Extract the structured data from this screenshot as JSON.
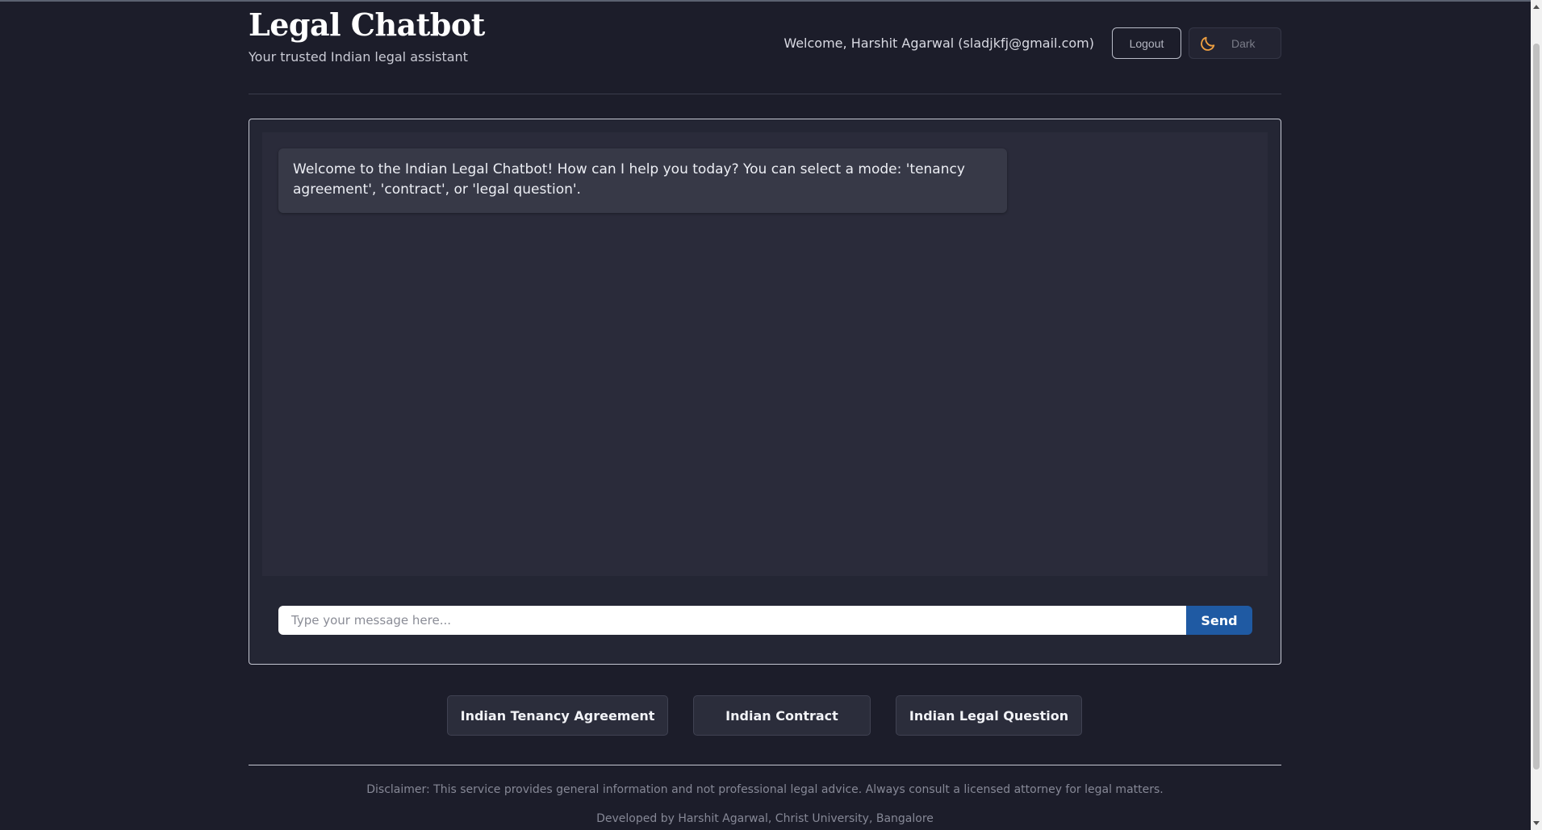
{
  "header": {
    "title": "Legal Chatbot",
    "subtitle": "Your trusted Indian legal assistant",
    "welcome": "Welcome, Harshit Agarwal (sladjkfj@gmail.com)",
    "logout_label": "Logout",
    "theme_label": "Dark",
    "theme_icon": "moon-icon"
  },
  "chat": {
    "messages": [
      {
        "role": "bot",
        "text": "Welcome to the Indian Legal Chatbot! How can I help you today? You can select a mode: 'tenancy agreement', 'contract', or 'legal question'."
      }
    ],
    "input_placeholder": "Type your message here...",
    "input_value": "",
    "send_label": "Send"
  },
  "modes": [
    {
      "label": "Indian Tenancy Agreement"
    },
    {
      "label": "Indian Contract"
    },
    {
      "label": "Indian Legal Question"
    }
  ],
  "footer": {
    "disclaimer": "Disclaimer: This service provides general information and not professional legal advice. Always consult a licensed attorney for legal matters.",
    "credit": "Developed by Harshit Agarwal, Christ University, Bangalore"
  },
  "colors": {
    "background": "#1c1d2a",
    "card": "#242634",
    "message_bubble": "#373947",
    "send_button": "#1f5aa3",
    "moon_icon": "#f0a040"
  }
}
